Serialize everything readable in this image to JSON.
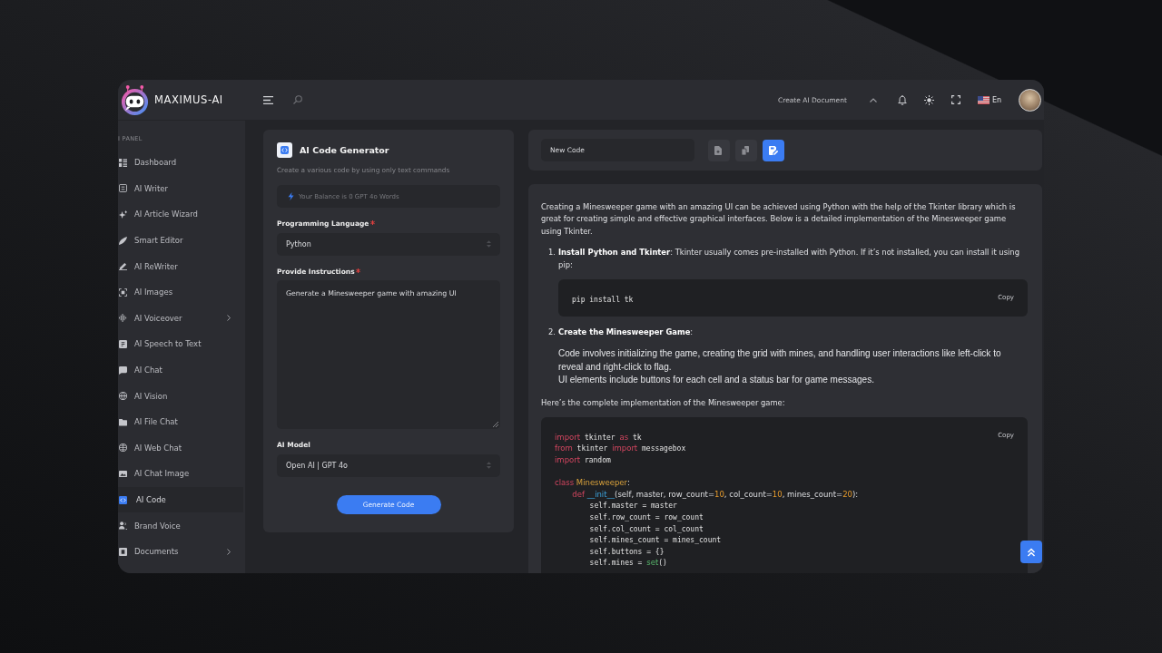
{
  "top_bar": {
    "logo_text": "MAXIMUS-AI",
    "document_menu": "Create AI Document",
    "language": "En"
  },
  "sidebar": {
    "section_label": "I PANEL",
    "items": [
      {
        "label": "Dashboard",
        "selected": false,
        "has_submenu": false
      },
      {
        "label": "AI Writer",
        "selected": false,
        "has_submenu": false
      },
      {
        "label": "AI Article Wizard",
        "selected": false,
        "has_submenu": false
      },
      {
        "label": "Smart Editor",
        "selected": false,
        "has_submenu": false
      },
      {
        "label": "AI ReWriter",
        "selected": false,
        "has_submenu": false
      },
      {
        "label": "AI Images",
        "selected": false,
        "has_submenu": false
      },
      {
        "label": "AI Voiceover",
        "selected": false,
        "has_submenu": true
      },
      {
        "label": "AI Speech to Text",
        "selected": false,
        "has_submenu": false
      },
      {
        "label": "AI Chat",
        "selected": false,
        "has_submenu": false
      },
      {
        "label": "AI Vision",
        "selected": false,
        "has_submenu": false
      },
      {
        "label": "AI File Chat",
        "selected": false,
        "has_submenu": false
      },
      {
        "label": "AI Web Chat",
        "selected": false,
        "has_submenu": false
      },
      {
        "label": "AI Chat Image",
        "selected": false,
        "has_submenu": false
      },
      {
        "label": "AI Code",
        "selected": true,
        "has_submenu": false
      },
      {
        "label": "Brand Voice",
        "selected": false,
        "has_submenu": false
      },
      {
        "label": "Documents",
        "selected": false,
        "has_submenu": true
      }
    ]
  },
  "generator": {
    "title": "AI Code Generator",
    "subtitle": "Create a various code by using only text commands",
    "balance": "Your Balance is 0 GPT 4o Words",
    "fields": [
      {
        "kind": "select",
        "label": "Programming Language",
        "required": true,
        "value": "Python"
      },
      {
        "kind": "textarea",
        "label": "Provide Instructions",
        "required": true,
        "value": "Generate a Minesweeper game with amazing UI"
      },
      {
        "kind": "select",
        "label": "AI Model",
        "required": false,
        "value": "Open AI | GPT 4o"
      }
    ],
    "submit_button": "Generate Code"
  },
  "document": {
    "name": "New Code",
    "tools": [
      {
        "kind": "file",
        "primary": false
      },
      {
        "kind": "copy",
        "primary": false
      },
      {
        "kind": "edit",
        "primary": true
      }
    ]
  },
  "output": {
    "blocks": [
      {
        "kind": "paragraph",
        "text": "Creating a Minesweeper game with an amazing UI can be achieved using Python with the help of the Tkinter library which is great for creating simple and effective graphical interfaces. Below is a detailed implementation of the Minesweeper game using Tkinter."
      },
      {
        "kind": "list_item",
        "number": "1.",
        "text": "**Install Python and Tkinter**: Tkinter usually comes pre-installed with Python. If it’s not installed, you can install it using pip:",
        "blocks": [
          {
            "kind": "code",
            "copy_label": "Copy",
            "lines": [
              {
                "kind": "code",
                "tokens": [
                  {
                    "kind": "plain",
                    "text": "pip install tk"
                  }
                ]
              }
            ]
          }
        ]
      },
      {
        "kind": "list_item",
        "number": "2.",
        "text": "**Create the Minesweeper Game**:",
        "blocks": [
          {
            "kind": "detail",
            "text": "Code involves initializing the game, creating the grid with mines, and handling user interactions like left-click to reveal and right-click to flag."
          },
          {
            "kind": "detail",
            "text": "UI elements include buttons for each cell and a status bar for game messages."
          }
        ]
      },
      {
        "kind": "paragraph",
        "text": "Here’s the complete implementation of the Minesweeper game:"
      },
      {
        "kind": "code",
        "copy_label": "Copy",
        "lines": [
          {
            "kind": "code",
            "tokens": [
              {
                "kind": "keyword",
                "text": "import"
              },
              {
                "kind": "plain",
                "text": " tkinter "
              },
              {
                "kind": "keyword",
                "text": "as"
              },
              {
                "kind": "plain",
                "text": " tk"
              }
            ]
          },
          {
            "kind": "code",
            "tokens": [
              {
                "kind": "keyword",
                "text": "from"
              },
              {
                "kind": "plain",
                "text": " tkinter "
              },
              {
                "kind": "keyword",
                "text": "import"
              },
              {
                "kind": "plain",
                "text": " messagebox"
              }
            ]
          },
          {
            "kind": "code",
            "tokens": [
              {
                "kind": "keyword",
                "text": "import"
              },
              {
                "kind": "plain",
                "text": " random"
              }
            ]
          },
          {
            "kind": "blank"
          },
          {
            "kind": "code",
            "tokens": [
              {
                "kind": "keyword",
                "text": "class "
              },
              {
                "kind": "title",
                "text": "Minesweeper"
              },
              {
                "kind": "params",
                "text": ":"
              }
            ],
            "children": [
              {
                "kind": "code",
                "tokens": [
                  {
                    "kind": "keyword",
                    "text": "def "
                  },
                  {
                    "kind": "function",
                    "text": "__init__"
                  },
                  {
                    "kind": "params",
                    "text": "(self, master, row_count="
                  },
                  {
                    "kind": "number",
                    "text": "10"
                  },
                  {
                    "kind": "params",
                    "text": ", col_count="
                  },
                  {
                    "kind": "number",
                    "text": "10"
                  },
                  {
                    "kind": "params",
                    "text": ", mines_count="
                  },
                  {
                    "kind": "number",
                    "text": "20"
                  },
                  {
                    "kind": "params",
                    "text": "):"
                  }
                ],
                "children": [
                  {
                    "kind": "code",
                    "tokens": [
                      {
                        "kind": "plain",
                        "text": "self.master = master"
                      }
                    ]
                  },
                  {
                    "kind": "code",
                    "tokens": [
                      {
                        "kind": "plain",
                        "text": "self.row_count = row_count"
                      }
                    ]
                  },
                  {
                    "kind": "code",
                    "tokens": [
                      {
                        "kind": "plain",
                        "text": "self.col_count = col_count"
                      }
                    ]
                  },
                  {
                    "kind": "code",
                    "tokens": [
                      {
                        "kind": "plain",
                        "text": "self.mines_count = mines_count"
                      }
                    ]
                  },
                  {
                    "kind": "code",
                    "tokens": [
                      {
                        "kind": "plain",
                        "text": "self.buttons = {}"
                      }
                    ]
                  },
                  {
                    "kind": "code",
                    "tokens": [
                      {
                        "kind": "plain",
                        "text": "self.mines = "
                      },
                      {
                        "kind": "builtin",
                        "text": "set"
                      },
                      {
                        "kind": "plain",
                        "text": "()"
                      }
                    ]
                  }
                ]
              }
            ]
          }
        ]
      }
    ]
  }
}
